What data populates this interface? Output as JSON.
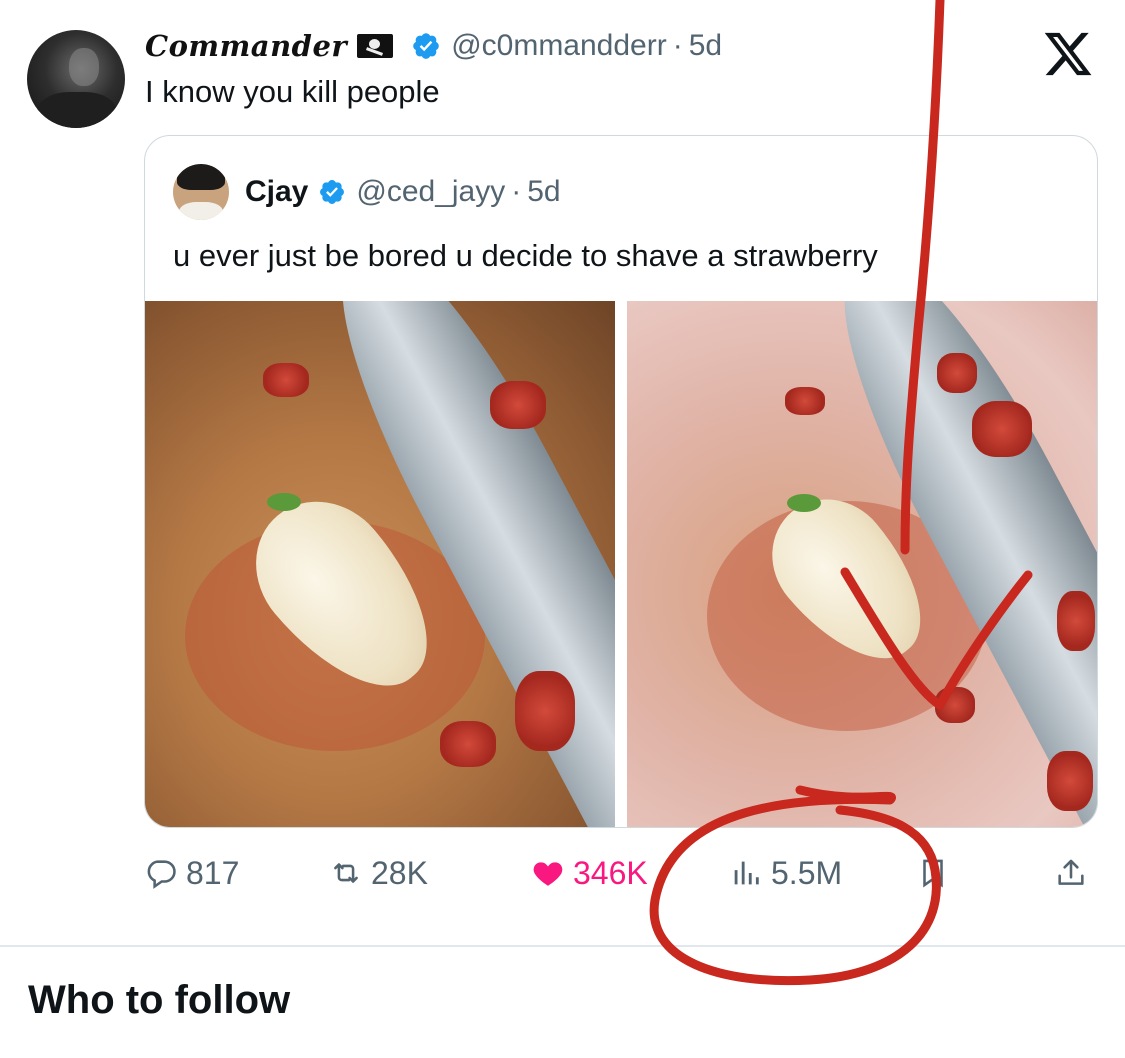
{
  "tweet": {
    "display_name": "Commander",
    "name_emoji": "pirate-flag-icon",
    "handle": "@c0mmandderr",
    "separator": "·",
    "time": "5d",
    "text": "I know you kill people",
    "platform_logo": "x-logo-icon"
  },
  "quoted_tweet": {
    "display_name": "Cjay",
    "handle": "@ced_jayy",
    "separator": "·",
    "time": "5d",
    "text": "u ever just be bored u decide to shave a strawberry"
  },
  "actions": {
    "replies": "817",
    "retweets": "28K",
    "likes": "346K",
    "views": "5.5M"
  },
  "section": {
    "title": "Who to follow"
  },
  "colors": {
    "text": "#0f1419",
    "secondary": "#536471",
    "verified": "#1d9bf0",
    "like": "#f91880",
    "annotation": "#c8281e"
  }
}
